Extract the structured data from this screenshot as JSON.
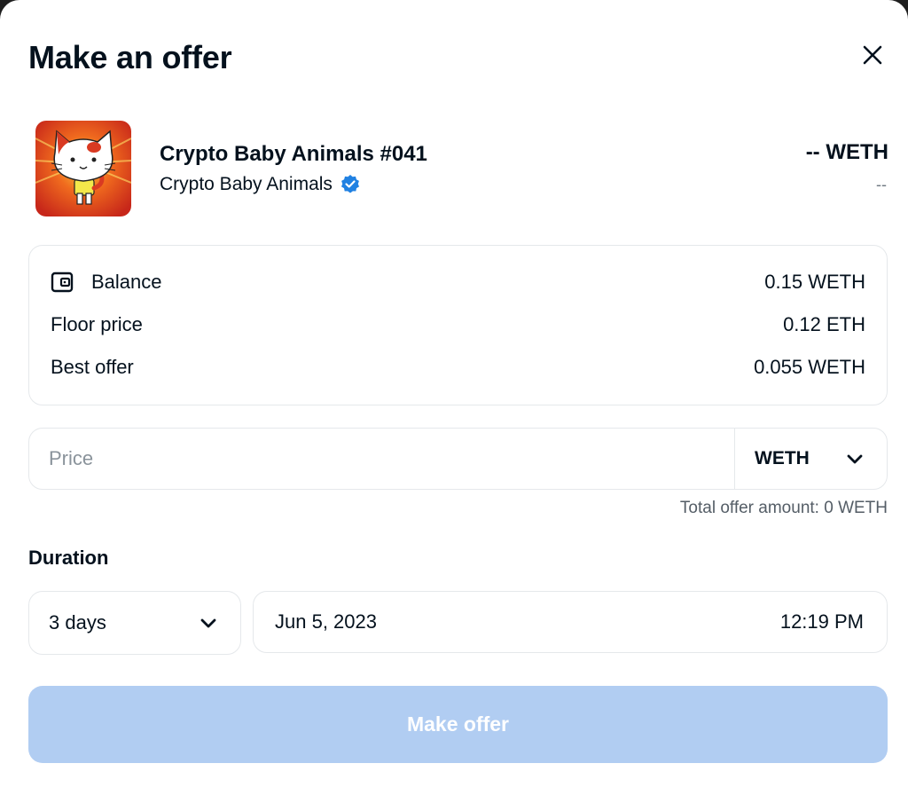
{
  "modal": {
    "title": "Make an offer"
  },
  "item": {
    "name": "Crypto Baby Animals #041",
    "collection": "Crypto Baby Animals",
    "verified": true,
    "price": "-- WETH",
    "price_usd": "--",
    "image_icon": "cartoon-cat-nft"
  },
  "info": {
    "rows": [
      {
        "label": "Balance",
        "value": "0.15 WETH",
        "icon": "wallet-icon"
      },
      {
        "label": "Floor price",
        "value": "0.12 ETH"
      },
      {
        "label": "Best offer",
        "value": "0.055 WETH"
      }
    ]
  },
  "price_field": {
    "placeholder": "Price",
    "value": "",
    "currency": "WETH"
  },
  "total": "Total offer amount: 0 WETH",
  "duration": {
    "label": "Duration",
    "selected": "3 days",
    "date": "Jun 5, 2023",
    "time": "12:19 PM"
  },
  "submit_label": "Make offer",
  "colors": {
    "text": "#04111d",
    "muted": "#707a83",
    "border": "#e5e8eb",
    "verified": "#2081e2",
    "button_disabled": "#b1cdf2"
  }
}
